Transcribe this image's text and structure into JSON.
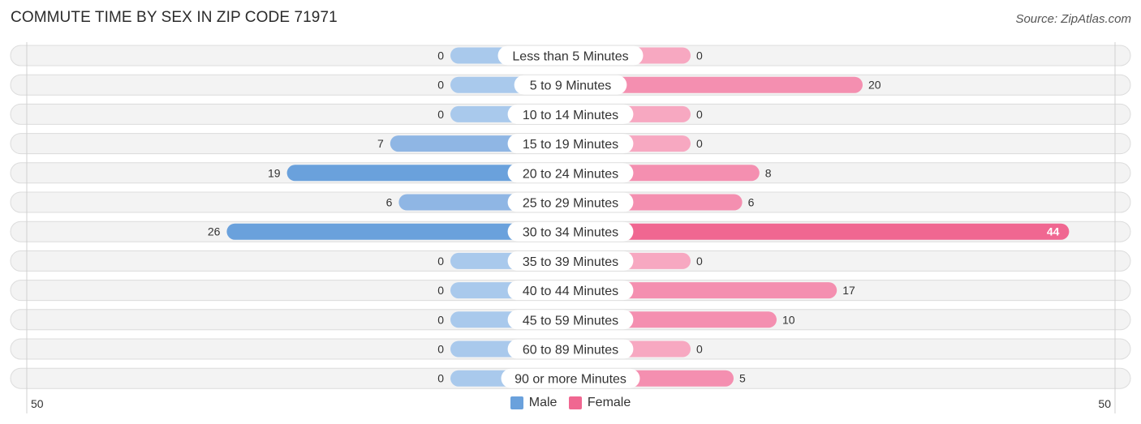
{
  "header": {
    "title": "COMMUTE TIME BY SEX IN ZIP CODE 71971",
    "source": "Source: ZipAtlas.com"
  },
  "colors": {
    "male_strong": "#6aa1dc",
    "male_light": "#a9c9ec",
    "female_strong": "#f06791",
    "female_light": "#f7a8c1"
  },
  "chart_data": {
    "type": "bar",
    "orientation": "horizontal-diverging",
    "title": "COMMUTE TIME BY SEX IN ZIP CODE 71971",
    "categories": [
      "Less than 5 Minutes",
      "5 to 9 Minutes",
      "10 to 14 Minutes",
      "15 to 19 Minutes",
      "20 to 24 Minutes",
      "25 to 29 Minutes",
      "30 to 34 Minutes",
      "35 to 39 Minutes",
      "40 to 44 Minutes",
      "45 to 59 Minutes",
      "60 to 89 Minutes",
      "90 or more Minutes"
    ],
    "series": [
      {
        "name": "Male",
        "values": [
          0,
          0,
          0,
          7,
          19,
          6,
          26,
          0,
          0,
          0,
          0,
          0
        ]
      },
      {
        "name": "Female",
        "values": [
          0,
          20,
          0,
          0,
          8,
          6,
          44,
          0,
          17,
          10,
          0,
          5
        ]
      }
    ],
    "axis": {
      "left_tick": "50",
      "right_tick": "50",
      "range": [
        50,
        50
      ]
    },
    "legend": {
      "position": "bottom-center",
      "entries": [
        "Male",
        "Female"
      ]
    },
    "xlabel": "",
    "ylabel": ""
  }
}
